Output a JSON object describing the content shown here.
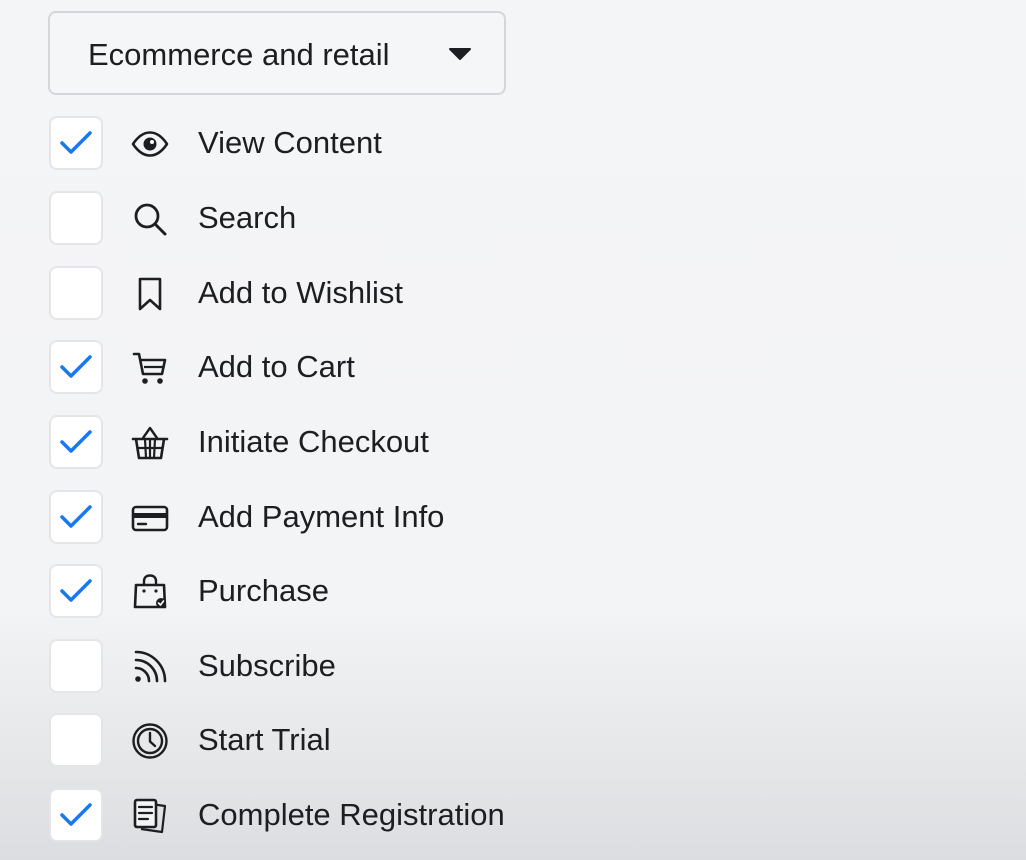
{
  "category_dropdown": {
    "label": "Ecommerce and retail",
    "icon": "caret-down-icon"
  },
  "colors": {
    "check": "#1877f2",
    "text": "#1c1e21",
    "checkbox_border": "#e3e5e8",
    "background": "#f3f4f6"
  },
  "events": [
    {
      "label": "View Content",
      "checked": true,
      "icon": "eye-icon"
    },
    {
      "label": "Search",
      "checked": false,
      "icon": "search-icon"
    },
    {
      "label": "Add to Wishlist",
      "checked": false,
      "icon": "bookmark-icon"
    },
    {
      "label": "Add to Cart",
      "checked": true,
      "icon": "cart-icon"
    },
    {
      "label": "Initiate Checkout",
      "checked": true,
      "icon": "basket-icon"
    },
    {
      "label": "Add Payment Info",
      "checked": true,
      "icon": "credit-card-icon"
    },
    {
      "label": "Purchase",
      "checked": true,
      "icon": "shopping-bag-icon"
    },
    {
      "label": "Subscribe",
      "checked": false,
      "icon": "rss-icon"
    },
    {
      "label": "Start Trial",
      "checked": false,
      "icon": "clock-icon"
    },
    {
      "label": "Complete Registration",
      "checked": true,
      "icon": "registration-form-icon"
    }
  ]
}
